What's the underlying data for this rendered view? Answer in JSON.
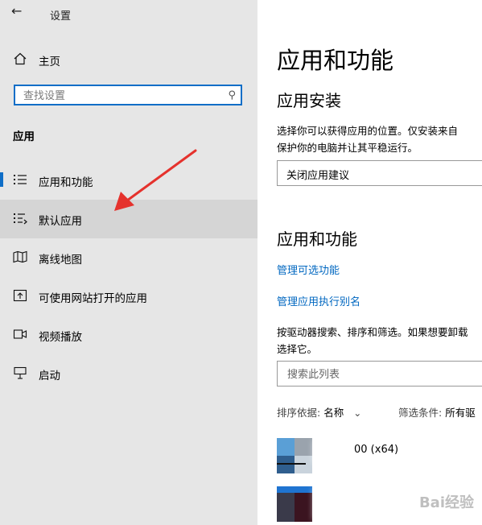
{
  "window": {
    "title": "设置",
    "back_icon": "back-arrow-icon"
  },
  "sidebar": {
    "home_label": "主页",
    "search": {
      "placeholder": "查找设置"
    },
    "section_label": "应用",
    "items": [
      {
        "label": "应用和功能",
        "icon": "apps-features-icon"
      },
      {
        "label": "默认应用",
        "icon": "default-apps-icon"
      },
      {
        "label": "离线地图",
        "icon": "offline-maps-icon"
      },
      {
        "label": "可使用网站打开的应用",
        "icon": "apps-for-websites-icon"
      },
      {
        "label": "视频播放",
        "icon": "video-playback-icon"
      },
      {
        "label": "启动",
        "icon": "startup-icon"
      }
    ],
    "selected_index": 0,
    "highlighted_index": 1
  },
  "main": {
    "title": "应用和功能",
    "install_heading": "应用安装",
    "install_desc_line1": "选择你可以获得应用的位置。仅安装来自",
    "install_desc_line2": "保护你的电脑并让其平稳运行。",
    "install_dropdown_value": "关闭应用建议",
    "features_heading": "应用和功能",
    "link_optional_features": "管理可选功能",
    "link_app_aliases": "管理应用执行别名",
    "search_desc_line1": "按驱动器搜索、排序和筛选。如果想要卸载",
    "search_desc_line2": "选择它。",
    "list_search_placeholder": "搜索此列表",
    "sort_label": "排序依据:",
    "sort_value": "名称",
    "filter_label": "筛选条件:",
    "filter_value": "所有驱",
    "apps": [
      {
        "name": "00 (x64)"
      }
    ]
  },
  "watermark": "Bai经验",
  "colors": {
    "accent": "#0f6ec7",
    "link": "#0067c0",
    "sidebar_bg": "#e6e6e6",
    "annotation_arrow": "#e5322d"
  }
}
